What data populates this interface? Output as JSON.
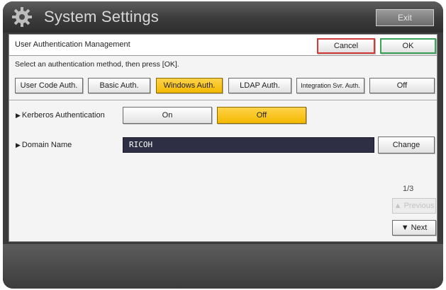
{
  "window": {
    "title": "System Settings",
    "exit_label": "Exit"
  },
  "screen": {
    "title": "User Authentication Management",
    "cancel_label": "Cancel",
    "ok_label": "OK",
    "instruction": "Select an authentication method, then press [OK]."
  },
  "auth_methods": [
    {
      "label": "User Code Auth.",
      "selected": false
    },
    {
      "label": "Basic Auth.",
      "selected": false
    },
    {
      "label": "Windows Auth.",
      "selected": true
    },
    {
      "label": "LDAP Auth.",
      "selected": false
    },
    {
      "label": "Integration Svr. Auth.",
      "selected": false
    },
    {
      "label": "Off",
      "selected": false
    }
  ],
  "kerberos": {
    "label": "Kerberos Authentication",
    "on_label": "On",
    "off_label": "Off",
    "value": "Off"
  },
  "domain": {
    "label": "Domain Name",
    "value": "RICOH",
    "change_label": "Change"
  },
  "pagination": {
    "indicator": "1/3",
    "previous_label": "Previous",
    "next_label": "Next"
  },
  "colors": {
    "selected": "#f3b900",
    "cancel_border": "#d33a3a",
    "ok_border": "#3ba35a",
    "field_bg": "#2e2f44"
  },
  "icons": {
    "title": "gear-icon",
    "previous": "triangle-up-icon",
    "next": "triangle-down-icon",
    "row_marker": "triangle-right-icon"
  }
}
